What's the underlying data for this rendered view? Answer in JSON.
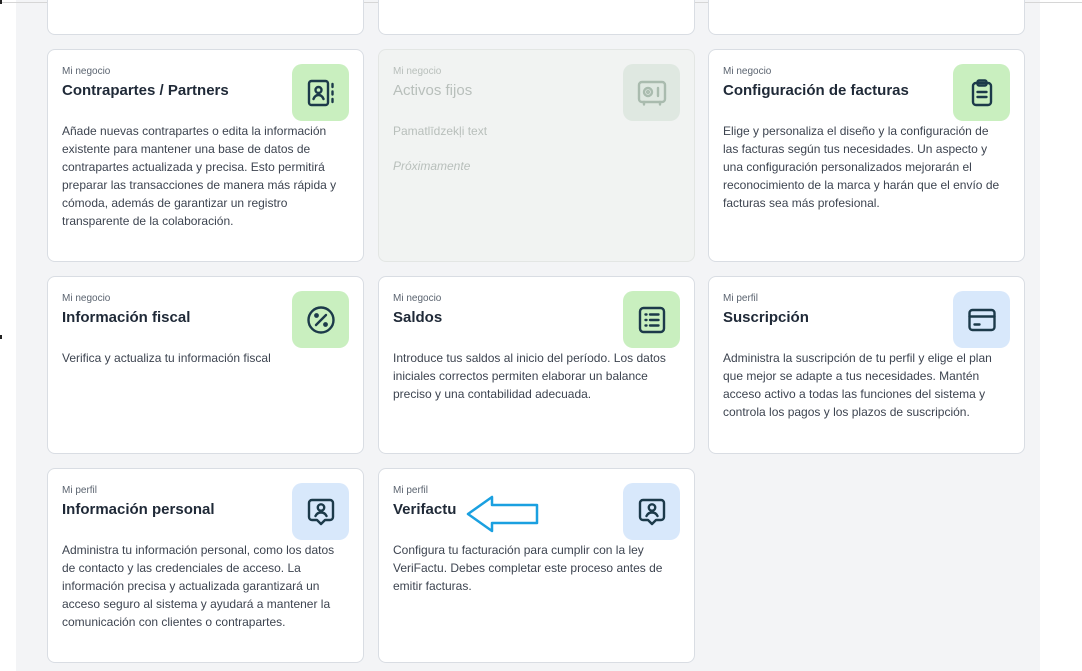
{
  "colors": {
    "accent_green_bg": "#c9efbf",
    "accent_blue_bg": "#d8e8fb",
    "icon_stroke": "#1c3a4a",
    "arrow": "#1aa0e0"
  },
  "cards": [
    {
      "category": "Mi negocio",
      "title": "Contrapartes / Partners",
      "description": "Añade nuevas contrapartes o edita la información existente para mantener una base de datos de contrapartes actualizada y precisa. Esto permitirá preparar las transacciones de manera más rápida y cómoda, además de garantizar un registro transparente de la colaboración.",
      "icon": "contacts-book-icon"
    },
    {
      "category": "Mi negocio",
      "title": "Activos fijos",
      "description": "Pamatlīdzekļi text",
      "status": "Próximamente",
      "icon": "safe-icon"
    },
    {
      "category": "Mi negocio",
      "title": "Configuración de facturas",
      "description": "Elige y personaliza el diseño y la configuración de las facturas según tus necesidades. Un aspecto y una configuración personalizados mejorarán el reconocimiento de la marca y harán que el envío de facturas sea más profesional.",
      "icon": "clipboard-icon"
    },
    {
      "category": "Mi negocio",
      "title": "Información fiscal",
      "description": "Verifica y actualiza tu información fiscal",
      "icon": "percent-icon"
    },
    {
      "category": "Mi negocio",
      "title": "Saldos",
      "description": "Introduce tus saldos al inicio del período. Los datos iniciales correctos permiten elaborar un balance preciso y una contabilidad adecuada.",
      "icon": "list-icon"
    },
    {
      "category": "Mi perfil",
      "title": "Suscripción",
      "description": "Administra la suscripción de tu perfil y elige el plan que mejor se adapte a tus necesidades. Mantén acceso activo a todas las funciones del sistema y controla los pagos y los plazos de suscripción.",
      "icon": "card-icon"
    },
    {
      "category": "Mi perfil",
      "title": "Información personal",
      "description": "Administra tu información personal, como los datos de contacto y las credenciales de acceso. La información precisa y actualizada garantizará un acceso seguro al sistema y ayudará a mantener la comunicación con clientes o contrapartes.",
      "icon": "user-badge-icon"
    },
    {
      "category": "Mi perfil",
      "title": "Verifactu",
      "description": "Configura tu facturación para cumplir con la ley VeriFactu. Debes completar este proceso antes de emitir facturas.",
      "icon": "user-badge-icon"
    }
  ],
  "annotation": {
    "icon": "arrow-left-icon"
  }
}
